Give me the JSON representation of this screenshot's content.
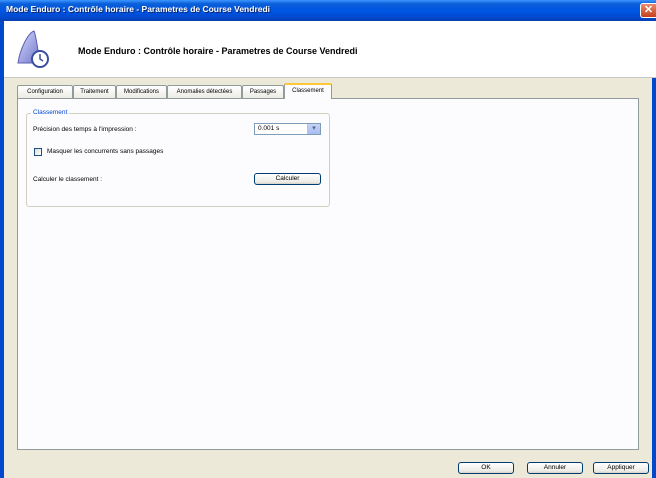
{
  "window": {
    "title": "Mode Enduro : Contrôle horaire - Parametres de Course Vendredi",
    "close_glyph": "✕"
  },
  "header": {
    "title": "Mode Enduro : Contrôle horaire - Parametres de Course Vendredi",
    "icon": "app-clock-icon"
  },
  "tabs": [
    {
      "label": "Configuration"
    },
    {
      "label": "Traitement"
    },
    {
      "label": "Modifications"
    },
    {
      "label": "Anomalies détectées"
    },
    {
      "label": "Passages"
    },
    {
      "label": "Classement",
      "active": true
    }
  ],
  "classement": {
    "group_title": "Classement",
    "precision_label": "Précision des temps à l'impression :",
    "precision_value": "0.001 s",
    "hide_label": "Masquer les concurrents sans passages",
    "hide_checked": false,
    "calc_label": "Calculer le classement :",
    "calc_button": "Calculer"
  },
  "footer": {
    "ok": "OK",
    "cancel": "Annuler",
    "apply": "Appliquer"
  },
  "colors": {
    "titlebar": "#0054e3",
    "group_title": "#0046d5",
    "active_tab_accent": "#ffc83c"
  }
}
